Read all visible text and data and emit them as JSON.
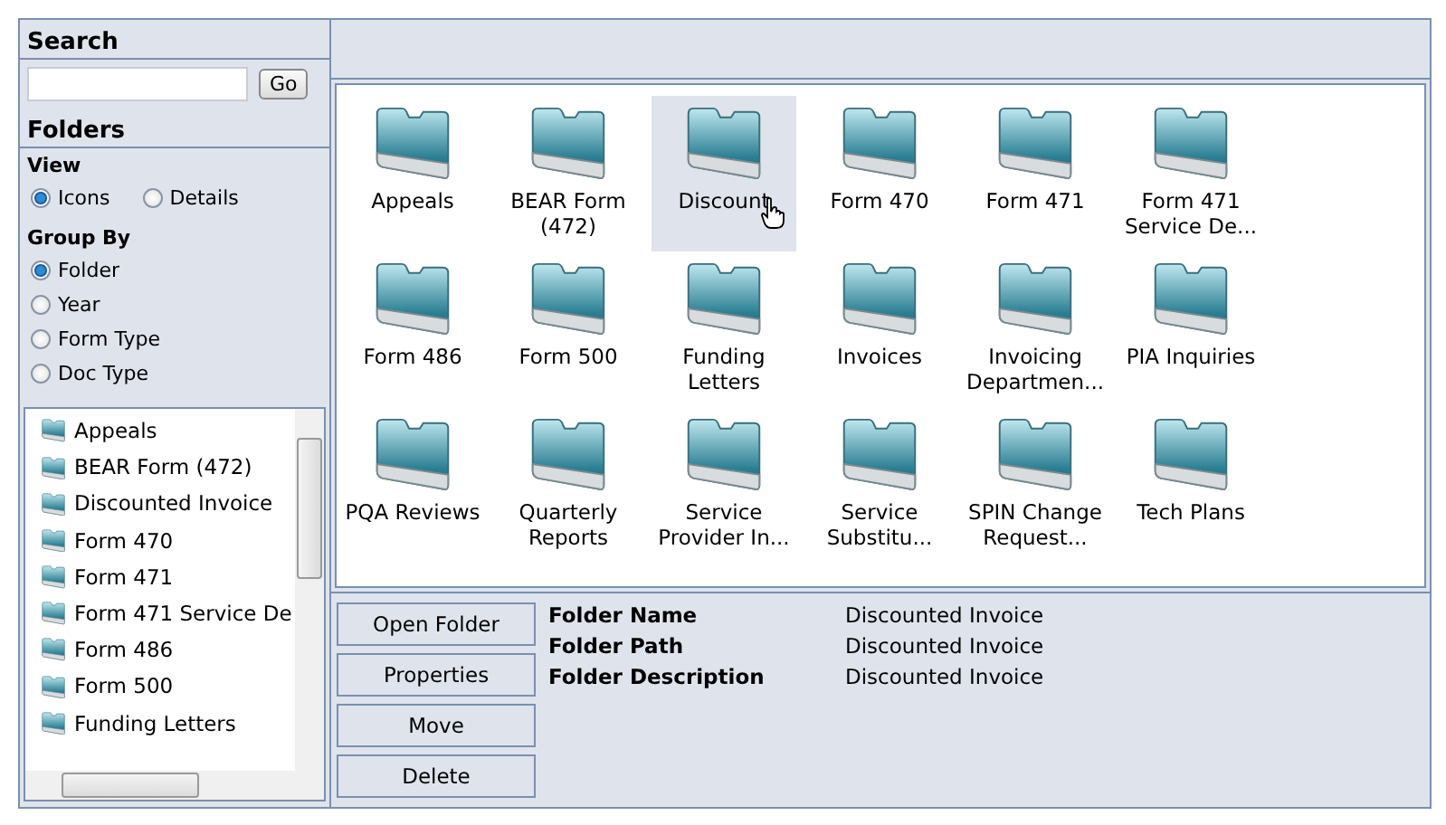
{
  "search": {
    "heading": "Search",
    "button": "Go"
  },
  "folders": {
    "heading": "Folders",
    "view": {
      "label": "View",
      "options": [
        {
          "label": "Icons",
          "selected": true
        },
        {
          "label": "Details",
          "selected": false
        }
      ]
    },
    "group_by": {
      "label": "Group By",
      "options": [
        {
          "label": "Folder",
          "selected": true
        },
        {
          "label": "Year",
          "selected": false
        },
        {
          "label": "Form Type",
          "selected": false
        },
        {
          "label": "Doc Type",
          "selected": false
        }
      ]
    },
    "tree": [
      "Appeals",
      "BEAR Form (472)",
      "Discounted Invoice",
      "Form 470",
      "Form 471",
      "Form 471 Service De",
      "Form 486",
      "Form 500",
      "Funding Letters"
    ]
  },
  "grid": [
    {
      "label": "Appeals",
      "selected": false
    },
    {
      "label": "BEAR Form (472)",
      "selected": false
    },
    {
      "label": "Discount",
      "selected": true
    },
    {
      "label": "Form 470",
      "selected": false
    },
    {
      "label": "Form 471",
      "selected": false
    },
    {
      "label": "Form 471 Service De...",
      "selected": false
    },
    {
      "label": "Form 486",
      "selected": false
    },
    {
      "label": "Form 500",
      "selected": false
    },
    {
      "label": "Funding Letters",
      "selected": false
    },
    {
      "label": "Invoices",
      "selected": false
    },
    {
      "label": "Invoicing Departmen...",
      "selected": false
    },
    {
      "label": "PIA Inquiries",
      "selected": false
    },
    {
      "label": "PQA Reviews",
      "selected": false
    },
    {
      "label": "Quarterly Reports",
      "selected": false
    },
    {
      "label": "Service Provider In...",
      "selected": false
    },
    {
      "label": "Service Substitu...",
      "selected": false
    },
    {
      "label": "SPIN Change Request...",
      "selected": false
    },
    {
      "label": "Tech Plans",
      "selected": false
    }
  ],
  "actions": [
    "Open Folder",
    "Properties",
    "Move",
    "Delete"
  ],
  "details": [
    {
      "label": "Folder Name",
      "value": "Discounted Invoice"
    },
    {
      "label": "Folder Path",
      "value": "Discounted Invoice"
    },
    {
      "label": "Folder Description",
      "value": "Discounted Invoice"
    }
  ]
}
